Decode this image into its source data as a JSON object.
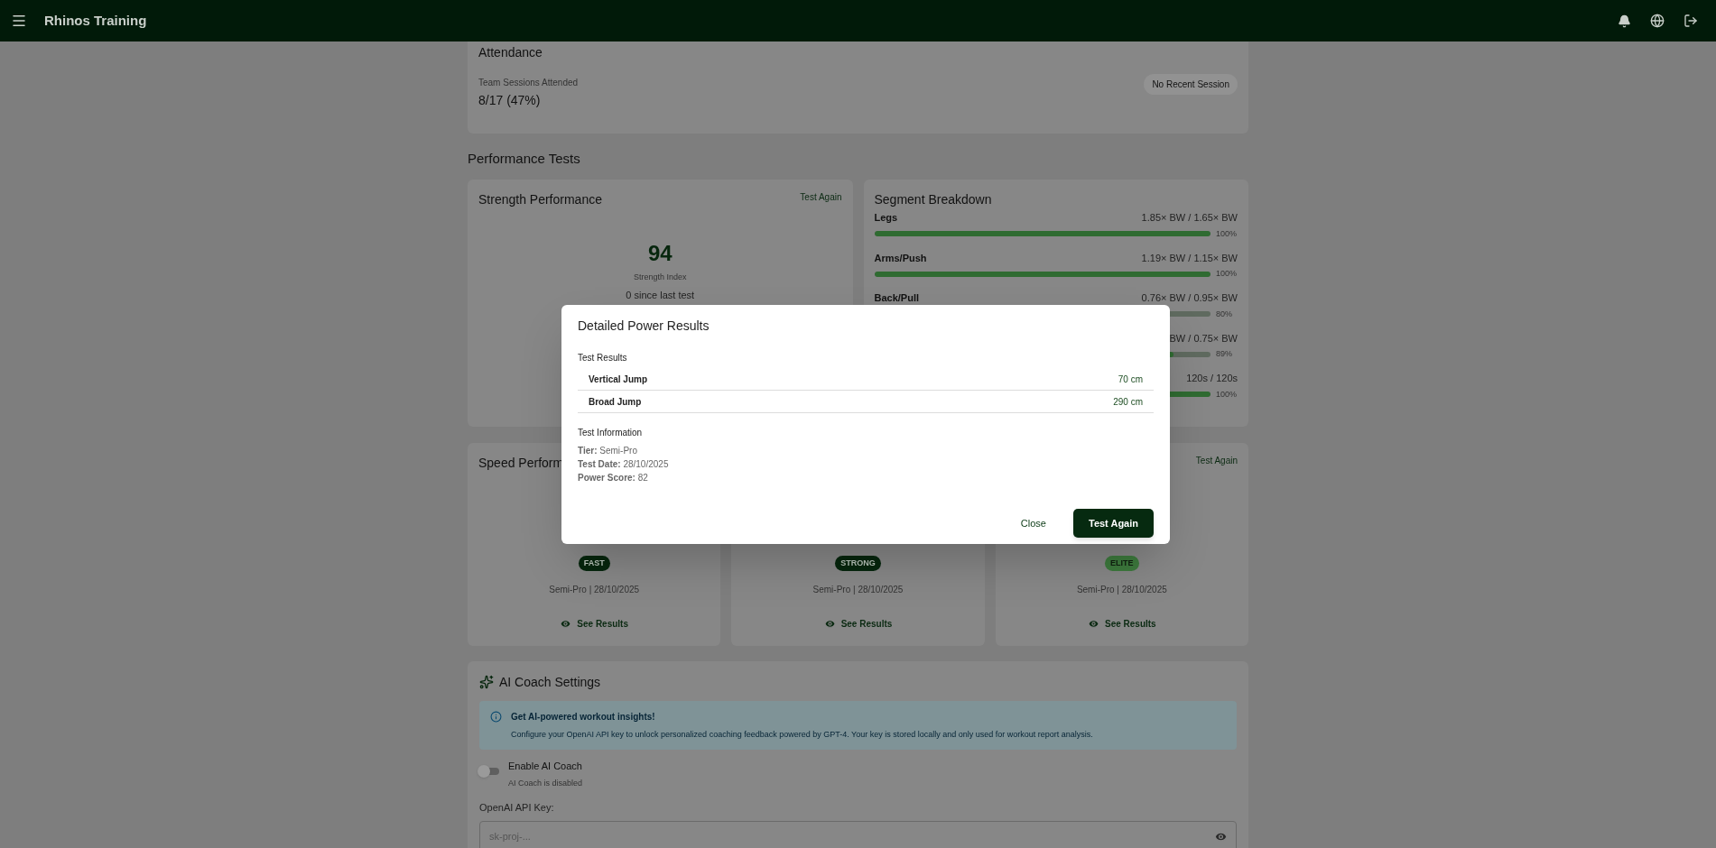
{
  "app_bar": {
    "title": "Rhinos Training"
  },
  "attendance": {
    "title": "Attendance",
    "label": "Team Sessions Attended",
    "value": "8/17 (47%)",
    "chip": "No Recent Session"
  },
  "performance_tests": {
    "heading": "Performance Tests",
    "strength": {
      "title": "Strength Performance",
      "action": "Test Again",
      "score": "94",
      "score_label": "Strength Index",
      "change": "0 since last test"
    },
    "segments": {
      "title": "Segment Breakdown",
      "rows": [
        {
          "label": "Legs",
          "value": "1.85× BW / 1.65× BW",
          "level": 1,
          "reading": "100%"
        },
        {
          "label": "Arms/Push",
          "value": "1.19× BW / 1.15× BW",
          "level": 1,
          "reading": "100%"
        },
        {
          "label": "Back/Pull",
          "value": "0.76× BW / 0.95× BW",
          "reading": "80%"
        },
        {
          "value": "BW / 0.75× BW",
          "level": 0.89,
          "reading": "89%"
        },
        {
          "value": "120s / 120s",
          "level": 1,
          "reading": "100%"
        }
      ]
    },
    "test_cards": [
      {
        "title": "Speed Perform",
        "badge": "FAST",
        "color": "#06260d",
        "meta": "Semi-Pro | 28/10/2025",
        "link": "See Results"
      },
      {
        "badge": "STRONG",
        "color": "#06260d",
        "meta": "Semi-Pro | 28/10/2025",
        "link": "See Results"
      },
      {
        "action": "Test Again",
        "badge": "ELITE",
        "color": "#3d7a3d",
        "meta": "Semi-Pro | 28/10/2025",
        "link": "See Results"
      }
    ]
  },
  "ai_coach": {
    "title": "AI Coach Settings",
    "alert": {
      "title": "Get AI-powered workout insights!",
      "text": "Configure your OpenAI API key to unlock personalized coaching feedback powered by GPT-4. Your key is stored locally and only used for workout report analysis."
    },
    "toggle": {
      "label": "Enable AI Coach",
      "hint": "AI Coach is disabled",
      "on": false
    },
    "api_key": {
      "label": "OpenAI API Key:",
      "placeholder": "sk-proj-..."
    }
  },
  "dialog": {
    "title": "Detailed Power Results",
    "results_heading": "Test Results",
    "results": [
      {
        "name": "Vertical Jump",
        "value": "70 cm"
      },
      {
        "name": "Broad Jump",
        "value": "290 cm"
      }
    ],
    "info_heading": "Test Information",
    "info": [
      {
        "label": "Tier:",
        "value": "Semi-Pro"
      },
      {
        "label": "Test Date:",
        "value": "28/10/2025"
      },
      {
        "label": "Power Score:",
        "value": "82"
      }
    ],
    "buttons": [
      {
        "label": "Close",
        "kind": "text"
      },
      {
        "label": "Test Again",
        "kind": "contained"
      }
    ]
  }
}
